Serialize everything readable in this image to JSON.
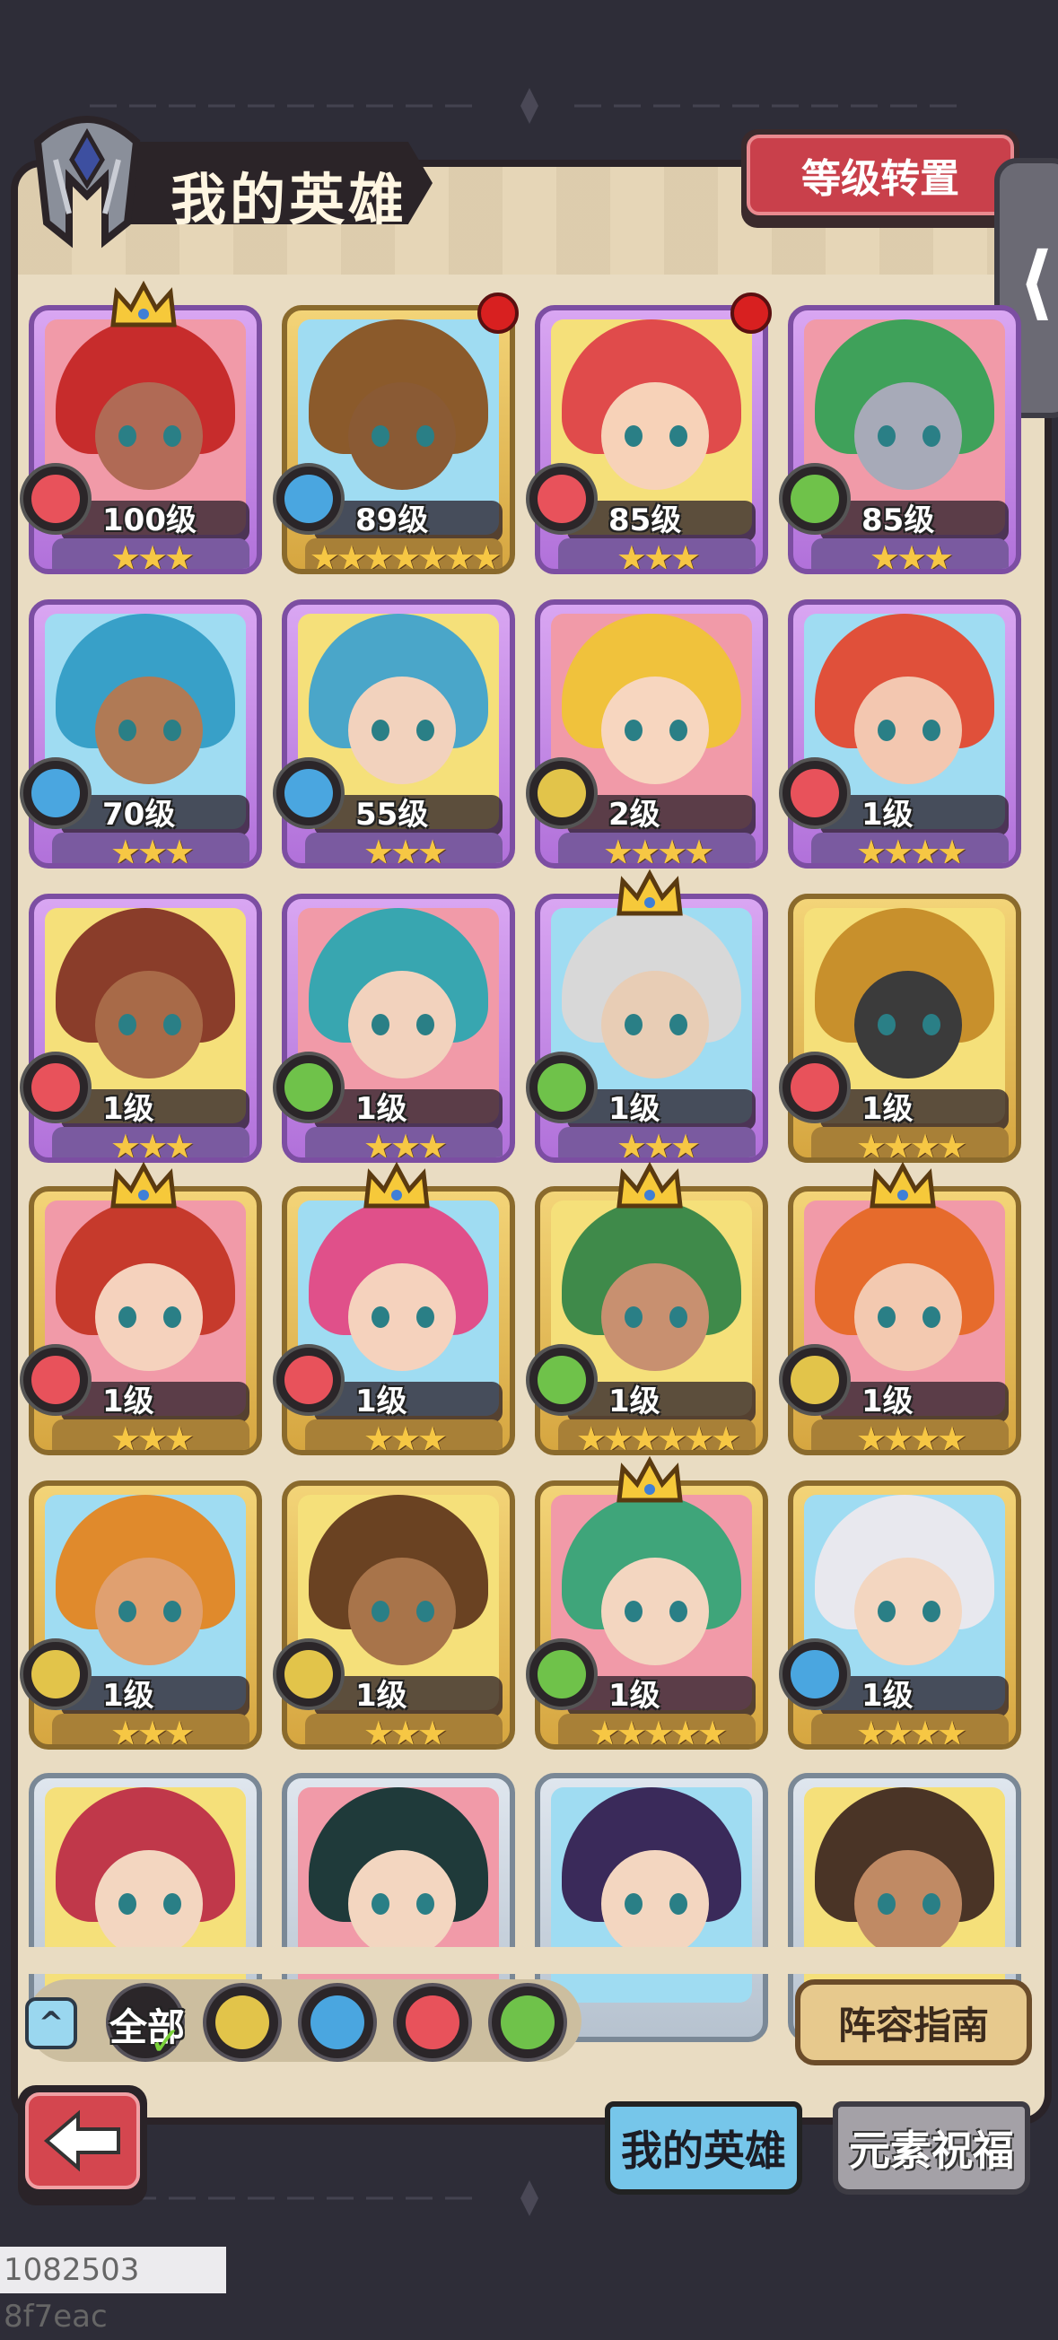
{
  "header": {
    "title": "我的英雄",
    "level_transfer_label": "等级转置",
    "side_tab_glyph": "⟨"
  },
  "heroes": [
    {
      "level": "100级",
      "stars": 3,
      "element": "fire",
      "frame": "purple",
      "crown": true,
      "alert": false,
      "hair": "#c72c2c",
      "skin": "#b06a55"
    },
    {
      "level": "89级",
      "stars": 7,
      "element": "water",
      "frame": "gold",
      "crown": false,
      "alert": true,
      "hair": "#8b5a2b",
      "skin": "#8a5a34"
    },
    {
      "level": "85级",
      "stars": 3,
      "element": "fire",
      "frame": "purple",
      "crown": false,
      "alert": true,
      "hair": "#e04b4b",
      "skin": "#f7d2b8"
    },
    {
      "level": "85级",
      "stars": 3,
      "element": "wind",
      "frame": "purple",
      "crown": false,
      "alert": false,
      "hair": "#3fa15a",
      "skin": "#a7aab8"
    },
    {
      "level": "70级",
      "stars": 3,
      "element": "water",
      "frame": "purple",
      "crown": false,
      "alert": false,
      "hair": "#38a0c8",
      "skin": "#b07a55"
    },
    {
      "level": "55级",
      "stars": 3,
      "element": "water",
      "frame": "purple",
      "crown": false,
      "alert": false,
      "hair": "#4aa6c9",
      "skin": "#f2d2bd"
    },
    {
      "level": "2级",
      "stars": 4,
      "element": "earth",
      "frame": "purple",
      "crown": false,
      "alert": false,
      "hair": "#f0c23c",
      "skin": "#f7d6bf"
    },
    {
      "level": "1级",
      "stars": 4,
      "element": "fire",
      "frame": "purple",
      "crown": false,
      "alert": false,
      "hair": "#e0503a",
      "skin": "#f3c7b0"
    },
    {
      "level": "1级",
      "stars": 3,
      "element": "fire",
      "frame": "purple",
      "crown": false,
      "alert": false,
      "hair": "#8a3d2a",
      "skin": "#a86a48"
    },
    {
      "level": "1级",
      "stars": 3,
      "element": "wind",
      "frame": "purple",
      "crown": false,
      "alert": false,
      "hair": "#38a6b0",
      "skin": "#f2d2bd"
    },
    {
      "level": "1级",
      "stars": 3,
      "element": "wind",
      "frame": "purple",
      "crown": true,
      "alert": false,
      "hair": "#d8d8d8",
      "skin": "#e8cdb5"
    },
    {
      "level": "1级",
      "stars": 4,
      "element": "fire",
      "frame": "gold",
      "crown": false,
      "alert": false,
      "hair": "#c8902c",
      "skin": "#3b3b3b"
    },
    {
      "level": "1级",
      "stars": 3,
      "element": "fire",
      "frame": "gold",
      "crown": true,
      "alert": false,
      "hair": "#c63a2c",
      "skin": "#f5d2bd"
    },
    {
      "level": "1级",
      "stars": 3,
      "element": "fire",
      "frame": "gold",
      "crown": true,
      "alert": false,
      "hair": "#e0508a",
      "skin": "#f5d2bd"
    },
    {
      "level": "1级",
      "stars": 6,
      "element": "wind",
      "frame": "gold",
      "crown": true,
      "alert": false,
      "hair": "#3f8a4a",
      "skin": "#c89070"
    },
    {
      "level": "1级",
      "stars": 4,
      "element": "earth",
      "frame": "gold",
      "crown": true,
      "alert": false,
      "hair": "#e66b2c",
      "skin": "#f3c9b0"
    },
    {
      "level": "1级",
      "stars": 3,
      "element": "earth",
      "frame": "gold",
      "crown": false,
      "alert": false,
      "hair": "#e08a2c",
      "skin": "#e0a070"
    },
    {
      "level": "1级",
      "stars": 3,
      "element": "earth",
      "frame": "gold",
      "crown": false,
      "alert": false,
      "hair": "#6a4222",
      "skin": "#a8744a"
    },
    {
      "level": "1级",
      "stars": 5,
      "element": "wind",
      "frame": "gold",
      "crown": true,
      "alert": false,
      "hair": "#3fa57a",
      "skin": "#f3d6c0"
    },
    {
      "level": "1级",
      "stars": 4,
      "element": "water",
      "frame": "gold",
      "crown": false,
      "alert": false,
      "hair": "#e8e8ee",
      "skin": "#f3d6c0"
    },
    {
      "level": "",
      "stars": 0,
      "element": "",
      "frame": "silver",
      "crown": false,
      "alert": false,
      "hair": "#c0384a",
      "skin": "#f3d6c0"
    },
    {
      "level": "",
      "stars": 0,
      "element": "",
      "frame": "silver",
      "crown": false,
      "alert": false,
      "hair": "#1f3a3a",
      "skin": "#f3d6c0"
    },
    {
      "level": "",
      "stars": 0,
      "element": "",
      "frame": "silver",
      "crown": false,
      "alert": false,
      "hair": "#3a2a5a",
      "skin": "#f3d6c0"
    },
    {
      "level": "",
      "stars": 0,
      "element": "",
      "frame": "silver",
      "crown": false,
      "alert": false,
      "hair": "#4a3426",
      "skin": "#c08a64"
    }
  ],
  "filters": {
    "all_label": "全部",
    "items": [
      "earth",
      "water",
      "fire",
      "wind"
    ]
  },
  "buttons": {
    "collapse_glyph": "^",
    "guide_label": "阵容指南",
    "back_glyph": "⇦"
  },
  "tabs": {
    "my_heroes": "我的英雄",
    "element_blessing": "元素祝福"
  },
  "footer": {
    "build_id": "1082503 8f7eac"
  },
  "colors": {
    "fire": "#e8525b",
    "water": "#4aa6e0",
    "earth": "#e2c44a",
    "wind": "#6fc24a",
    "accent_red": "#c9404b",
    "tab_active": "#76c6ea"
  }
}
